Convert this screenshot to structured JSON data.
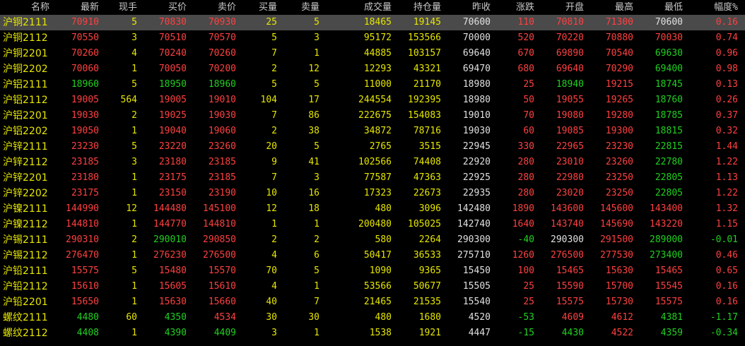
{
  "headers": [
    "名称",
    "最新",
    "现手",
    "买价",
    "卖价",
    "买量",
    "卖量",
    "成交量",
    "持仓量",
    "昨收",
    "涨跌",
    "开盘",
    "最高",
    "最低",
    "幅度%"
  ],
  "rows": [
    [
      "沪铜2111",
      "70910",
      "5",
      "70830",
      "70930",
      "25",
      "5",
      "18465",
      "19145",
      "70600",
      "110",
      "70810",
      "71300",
      "70600",
      "0.16"
    ],
    [
      "沪铜2112",
      "70550",
      "3",
      "70510",
      "70570",
      "5",
      "3",
      "95172",
      "153566",
      "70000",
      "520",
      "70220",
      "70880",
      "70030",
      "0.74"
    ],
    [
      "沪铜2201",
      "70260",
      "4",
      "70240",
      "70260",
      "7",
      "1",
      "44885",
      "103157",
      "69640",
      "670",
      "69890",
      "70540",
      "69630",
      "0.96"
    ],
    [
      "沪铜2202",
      "70060",
      "1",
      "70050",
      "70200",
      "2",
      "12",
      "12293",
      "43321",
      "69470",
      "680",
      "69640",
      "70290",
      "69400",
      "0.98"
    ],
    [
      "沪铝2111",
      "18960",
      "5",
      "18950",
      "18960",
      "5",
      "5",
      "11000",
      "21170",
      "18980",
      "25",
      "18940",
      "19215",
      "18745",
      "0.13"
    ],
    [
      "沪铝2112",
      "19005",
      "564",
      "19005",
      "19010",
      "104",
      "17",
      "244554",
      "192395",
      "18980",
      "50",
      "19055",
      "19265",
      "18760",
      "0.26"
    ],
    [
      "沪铝2201",
      "19030",
      "2",
      "19025",
      "19030",
      "7",
      "86",
      "222675",
      "154083",
      "19010",
      "70",
      "19080",
      "19280",
      "18785",
      "0.37"
    ],
    [
      "沪铝2202",
      "19050",
      "1",
      "19040",
      "19060",
      "2",
      "38",
      "34872",
      "78716",
      "19030",
      "60",
      "19085",
      "19300",
      "18815",
      "0.32"
    ],
    [
      "沪锌2111",
      "23230",
      "5",
      "23220",
      "23260",
      "20",
      "5",
      "2765",
      "3515",
      "22945",
      "330",
      "22965",
      "23230",
      "22815",
      "1.44"
    ],
    [
      "沪锌2112",
      "23185",
      "3",
      "23180",
      "23185",
      "9",
      "41",
      "102566",
      "74408",
      "22920",
      "280",
      "23010",
      "23260",
      "22780",
      "1.22"
    ],
    [
      "沪锌2201",
      "23180",
      "1",
      "23175",
      "23185",
      "7",
      "3",
      "77587",
      "47363",
      "22925",
      "280",
      "22980",
      "23250",
      "22805",
      "1.13"
    ],
    [
      "沪锌2202",
      "23175",
      "1",
      "23150",
      "23190",
      "10",
      "16",
      "17323",
      "22673",
      "22935",
      "280",
      "23020",
      "23250",
      "22805",
      "1.22"
    ],
    [
      "沪镍2111",
      "144990",
      "12",
      "144480",
      "145100",
      "12",
      "18",
      "480",
      "3096",
      "142480",
      "1890",
      "143600",
      "145600",
      "143400",
      "1.32"
    ],
    [
      "沪镍2112",
      "144810",
      "1",
      "144770",
      "144810",
      "1",
      "1",
      "200480",
      "105025",
      "142740",
      "1640",
      "143740",
      "145690",
      "143220",
      "1.15"
    ],
    [
      "沪锡2111",
      "290310",
      "2",
      "290010",
      "290850",
      "2",
      "2",
      "580",
      "2264",
      "290300",
      "-40",
      "290300",
      "291500",
      "289000",
      "-0.01"
    ],
    [
      "沪锡2112",
      "276470",
      "1",
      "276230",
      "276500",
      "4",
      "6",
      "50417",
      "36533",
      "275710",
      "1260",
      "276500",
      "277530",
      "273400",
      "0.46"
    ],
    [
      "沪铅2111",
      "15575",
      "5",
      "15480",
      "15570",
      "70",
      "5",
      "1090",
      "9365",
      "15450",
      "100",
      "15465",
      "15630",
      "15465",
      "0.65"
    ],
    [
      "沪铅2112",
      "15610",
      "1",
      "15605",
      "15610",
      "4",
      "1",
      "53566",
      "50677",
      "15505",
      "25",
      "15590",
      "15700",
      "15545",
      "0.16"
    ],
    [
      "沪铅2201",
      "15650",
      "1",
      "15630",
      "15660",
      "40",
      "7",
      "21465",
      "21535",
      "15540",
      "25",
      "15575",
      "15730",
      "15575",
      "0.16"
    ],
    [
      "螺纹2111",
      "4480",
      "60",
      "4350",
      "4534",
      "30",
      "30",
      "480",
      "1680",
      "4520",
      "-53",
      "4609",
      "4612",
      "4381",
      "-1.17"
    ],
    [
      "螺纹2112",
      "4408",
      "1",
      "4390",
      "4409",
      "3",
      "1",
      "1538",
      "1921",
      "4447",
      "-15",
      "4430",
      "4522",
      "4359",
      "-0.34"
    ]
  ],
  "colors": {
    "up": "#ff4040",
    "down": "#20d020",
    "volume": "#e6e600",
    "neutral": "#e0e0e0",
    "header": "#c9c9c9",
    "selected_row_bg": "#4a4a4a"
  },
  "selected_row": 0
}
